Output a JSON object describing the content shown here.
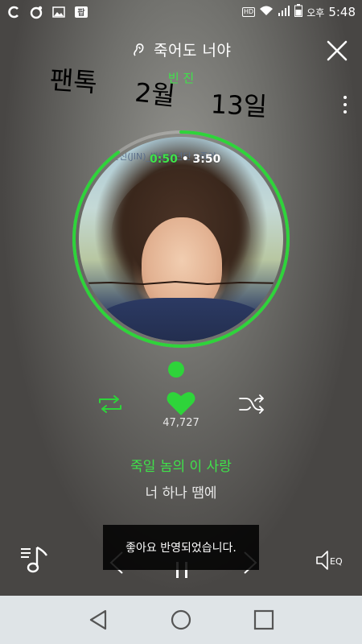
{
  "status_bar": {
    "left_icons": [
      "ok-cashbag-icon",
      "pig-app-icon",
      "gallery-icon",
      "baemin-app-icon"
    ],
    "hd_badge": "HD",
    "ampm": "오후",
    "time": "5:48",
    "battery_level": 0.6
  },
  "player": {
    "song_title": "죽어도 너야",
    "artist": "빈 진",
    "current_time": "0:50",
    "total_time": "3:50",
    "progress_fraction": 0.9,
    "like_count": "47,727",
    "lyric_current": "죽일 놈의 이 사랑",
    "lyric_next": "너 하나 땜에",
    "album_art_caption": "한진(JIN)_방탄소년단 | 죽어",
    "eq_label": "EQ"
  },
  "handwritten_note": {
    "word1": "팬톡",
    "word2": "2월",
    "word3": "13일"
  },
  "toast": {
    "message": "좋아요 반영되었습니다."
  },
  "colors": {
    "accent_green": "#2ed43a",
    "nav_bar": "#dfe4e7"
  }
}
